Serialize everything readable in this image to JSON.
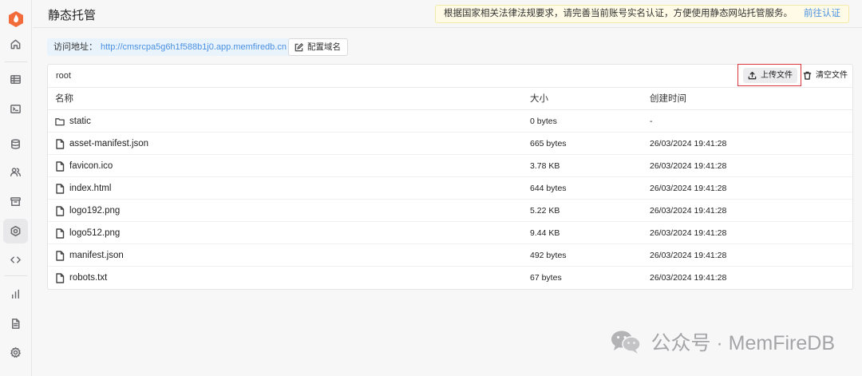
{
  "page": {
    "title": "静态托管"
  },
  "notice": {
    "text": "根据国家相关法律法规要求，请完善当前账号实名认证，方便使用静态网站托管服务。",
    "link": "前往认证"
  },
  "access": {
    "label": "访问地址：",
    "url": "http://cmsrcpa5g6h1f588b1j0.app.memfiredb.cn",
    "config_button": "配置域名"
  },
  "files": {
    "breadcrumb": "root",
    "upload_button": "上传文件",
    "clear_button": "清空文件",
    "columns": [
      "名称",
      "大小",
      "创建时间"
    ],
    "rows": [
      {
        "name": "static",
        "type": "folder",
        "size": "0 bytes",
        "created": "-"
      },
      {
        "name": "asset-manifest.json",
        "type": "file",
        "size": "665 bytes",
        "created": "26/03/2024 19:41:28"
      },
      {
        "name": "favicon.ico",
        "type": "file",
        "size": "3.78 KB",
        "created": "26/03/2024 19:41:28"
      },
      {
        "name": "index.html",
        "type": "file",
        "size": "644 bytes",
        "created": "26/03/2024 19:41:28"
      },
      {
        "name": "logo192.png",
        "type": "file",
        "size": "5.22 KB",
        "created": "26/03/2024 19:41:28"
      },
      {
        "name": "logo512.png",
        "type": "file",
        "size": "9.44 KB",
        "created": "26/03/2024 19:41:28"
      },
      {
        "name": "manifest.json",
        "type": "file",
        "size": "492 bytes",
        "created": "26/03/2024 19:41:28"
      },
      {
        "name": "robots.txt",
        "type": "file",
        "size": "67 bytes",
        "created": "26/03/2024 19:41:28"
      }
    ]
  },
  "sidebar": {
    "icons": [
      "home-icon",
      "table-icon",
      "terminal-icon",
      "database-icon",
      "users-icon",
      "archive-icon",
      "hosting-icon",
      "code-icon",
      "chart-icon",
      "document-icon",
      "settings-icon"
    ],
    "active": "hosting-icon"
  },
  "watermark": {
    "text": "公众号 · MemFireDB"
  },
  "colors": {
    "accent": "#4a90e2",
    "notice_bg": "#fffbe6",
    "highlight": "#d9363e",
    "logo": "#f26b3a"
  }
}
